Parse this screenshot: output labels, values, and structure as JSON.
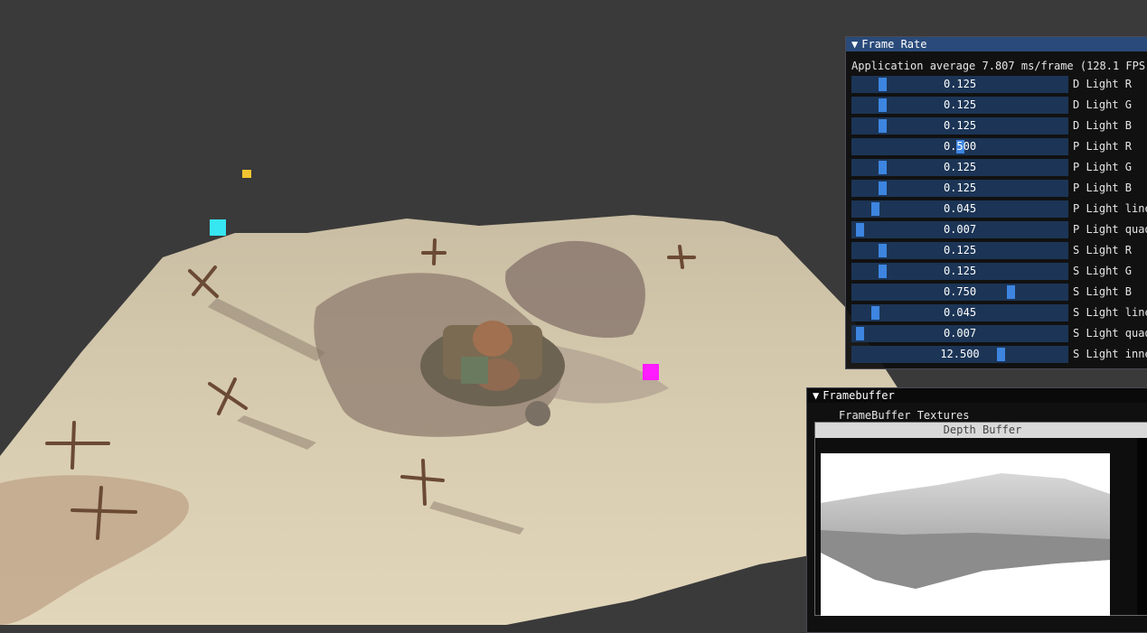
{
  "frame_window": {
    "title": "Frame Rate",
    "stats": "Application average 7.807 ms/frame (128.1 FPS)",
    "sliders": [
      {
        "label": "D Light R",
        "value": "0.125",
        "fraction": 0.125
      },
      {
        "label": "D Light G",
        "value": "0.125",
        "fraction": 0.125
      },
      {
        "label": "D Light B",
        "value": "0.125",
        "fraction": 0.125
      },
      {
        "label": "P Light R",
        "value": "0.500",
        "fraction": 0.5
      },
      {
        "label": "P Light G",
        "value": "0.125",
        "fraction": 0.125
      },
      {
        "label": "P Light B",
        "value": "0.125",
        "fraction": 0.125
      },
      {
        "label": "P Light line",
        "value": "0.045",
        "fraction": 0.09
      },
      {
        "label": "P Light quad",
        "value": "0.007",
        "fraction": 0.014
      },
      {
        "label": "S Light R",
        "value": "0.125",
        "fraction": 0.125
      },
      {
        "label": "S Light G",
        "value": "0.125",
        "fraction": 0.125
      },
      {
        "label": "S Light B",
        "value": "0.750",
        "fraction": 0.75
      },
      {
        "label": "S Light line",
        "value": "0.045",
        "fraction": 0.09
      },
      {
        "label": "S Light quad",
        "value": "0.007",
        "fraction": 0.014
      },
      {
        "label": "S Light inne",
        "value": "12.500",
        "fraction": 0.7
      }
    ]
  },
  "framebuffer_window": {
    "title": "Framebuffer",
    "textures_label": "FrameBuffer Textures",
    "depth_title": "Depth Buffer"
  },
  "colors": {
    "title_active": "#294a7a",
    "slider_bg": "#1c3556",
    "slider_grab": "#3d85e0",
    "viewport_bg": "#3a3a3a"
  }
}
